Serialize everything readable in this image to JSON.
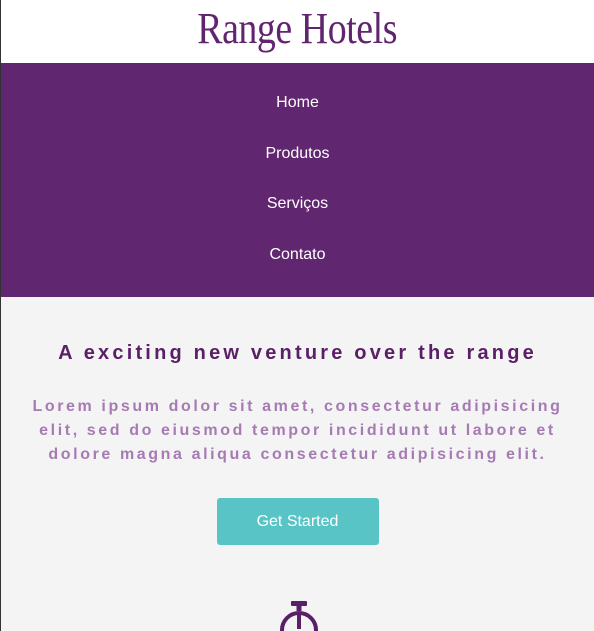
{
  "brand": {
    "name": "Range Hotels"
  },
  "nav": {
    "items": [
      {
        "label": "Home"
      },
      {
        "label": "Produtos"
      },
      {
        "label": "Serviços"
      },
      {
        "label": "Contato"
      }
    ]
  },
  "hero": {
    "title": "A exciting new venture over the range",
    "text": "Lorem ipsum dolor sit amet, consectetur adipisicing elit, sed do eiusmod tempor incididunt ut labore et dolore magna aliqua consectetur adipisicing elit.",
    "cta_label": "Get Started",
    "icon": "stopwatch-icon"
  },
  "colors": {
    "brand_purple": "#612670",
    "hero_text": "#a67bb4",
    "cta": "#59c4c6",
    "hero_bg": "#f4f4f4"
  }
}
